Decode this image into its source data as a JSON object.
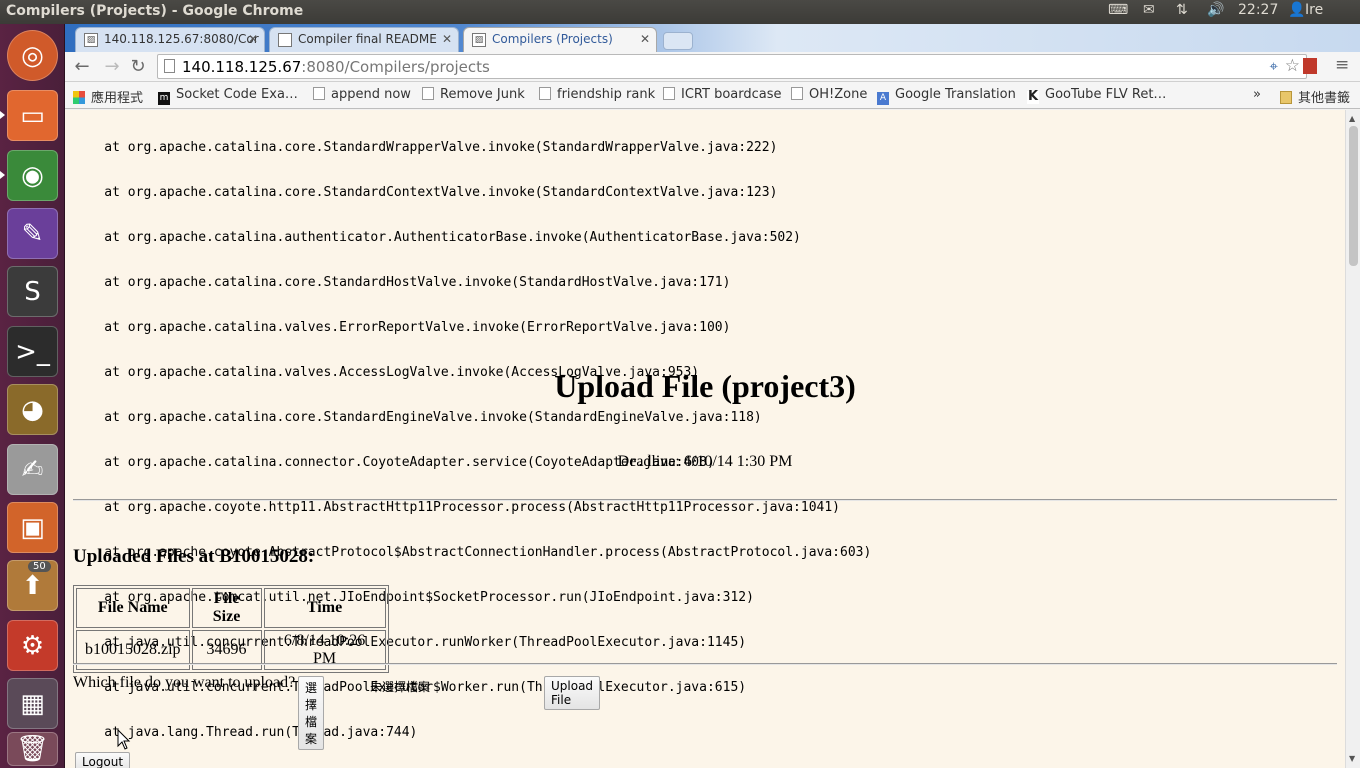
{
  "window": {
    "title": "Compilers (Projects) - Google Chrome",
    "clock": "22:27",
    "user": "Ire"
  },
  "launcher": {
    "badge": "50",
    "items": [
      "ubuntu-dash",
      "files",
      "chrome",
      "inkscape",
      "sublime-text",
      "terminal",
      "gimp",
      "text-editor",
      "software-center",
      "update-manager",
      "system-settings",
      "workspace-switcher",
      "trash"
    ]
  },
  "tabs": [
    {
      "label": "140.118.125.67:8080/Cor",
      "active": false
    },
    {
      "label": "Compiler final README",
      "active": false
    },
    {
      "label": "Compilers (Projects)",
      "active": true
    }
  ],
  "address": {
    "host": "140.118.125.67",
    "rest": ":8080/Compilers/projects"
  },
  "bookmarks": [
    {
      "label": "應用程式",
      "icon": "apps-grid-icon"
    },
    {
      "label": "Socket Code Exa…",
      "icon": "m-icon"
    },
    {
      "label": "append now",
      "icon": "page-icon"
    },
    {
      "label": "Remove Junk",
      "icon": "page-icon"
    },
    {
      "label": "friendship rank",
      "icon": "page-icon"
    },
    {
      "label": "ICRT boardcase",
      "icon": "page-icon"
    },
    {
      "label": "OH!Zone",
      "icon": "page-icon"
    },
    {
      "label": "Google Translation",
      "icon": "translate-icon"
    },
    {
      "label": "GooTube FLV Ret…",
      "icon": "k-icon"
    },
    {
      "label": "其他書籤",
      "icon": "folder-icon"
    }
  ],
  "stack_trace": [
    "    at org.apache.catalina.core.StandardWrapperValve.invoke(StandardWrapperValve.java:222)",
    "    at org.apache.catalina.core.StandardContextValve.invoke(StandardContextValve.java:123)",
    "    at org.apache.catalina.authenticator.AuthenticatorBase.invoke(AuthenticatorBase.java:502)",
    "    at org.apache.catalina.core.StandardHostValve.invoke(StandardHostValve.java:171)",
    "    at org.apache.catalina.valves.ErrorReportValve.invoke(ErrorReportValve.java:100)",
    "    at org.apache.catalina.valves.AccessLogValve.invoke(AccessLogValve.java:953)",
    "    at org.apache.catalina.core.StandardEngineValve.invoke(StandardEngineValve.java:118)",
    "    at org.apache.catalina.connector.CoyoteAdapter.service(CoyoteAdapter.java:408)",
    "    at org.apache.coyote.http11.AbstractHttp11Processor.process(AbstractHttp11Processor.java:1041)",
    "    at org.apache.coyote.AbstractProtocol$AbstractConnectionHandler.process(AbstractProtocol.java:603)",
    "    at org.apache.tomcat.util.net.JIoEndpoint$SocketProcessor.run(JIoEndpoint.java:312)",
    "    at java.util.concurrent.ThreadPoolExecutor.runWorker(ThreadPoolExecutor.java:1145)",
    "    at java.util.concurrent.ThreadPoolExecutor$Worker.run(ThreadPoolExecutor.java:615)",
    "    at java.lang.Thread.run(Thread.java:744)"
  ],
  "page": {
    "title": "Upload File (project3)",
    "deadline": "Deadline: 6/10/14 1:30 PM",
    "uploaded_heading": "Uploaded Files at B10015028:",
    "table": {
      "headers": [
        "File Name",
        "File Size",
        "Time"
      ],
      "rows": [
        [
          "b10015028.zip",
          "34696",
          "6/8/14 10:26 PM"
        ]
      ]
    },
    "upload_prompt": "Which file do you want to upload?",
    "choose_file_label": "選擇檔案",
    "no_file_label": "未選擇檔案",
    "upload_button": "Upload File",
    "logout_button": "Logout"
  }
}
